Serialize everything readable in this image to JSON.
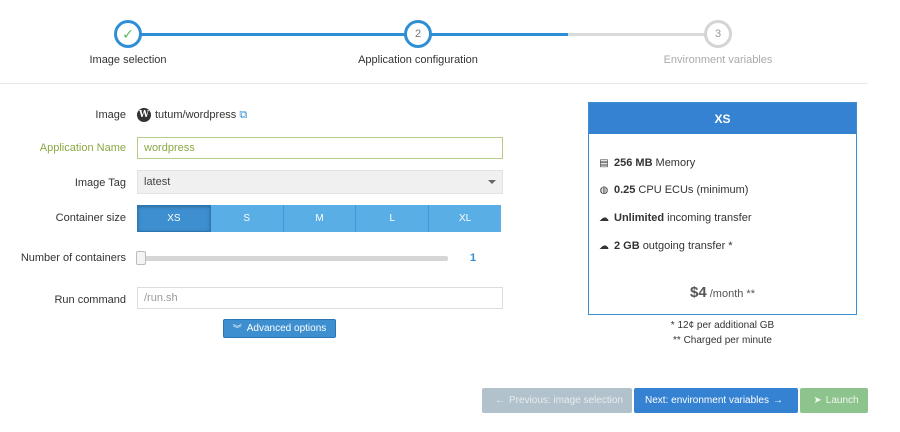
{
  "wizard": {
    "steps": [
      {
        "label": "Image selection",
        "marker": "✓",
        "state": "done"
      },
      {
        "label": "Application configuration",
        "marker": "2",
        "state": "active"
      },
      {
        "label": "Environment variables",
        "marker": "3",
        "state": "todo"
      }
    ]
  },
  "form": {
    "image": {
      "label": "Image",
      "value": "tutum/wordpress",
      "icon": "wordpress-icon",
      "link_icon": "external-link-icon"
    },
    "app_name": {
      "label": "Application Name",
      "value": "wordpress"
    },
    "image_tag": {
      "label": "Image Tag",
      "value": "latest"
    },
    "container_size": {
      "label": "Container size",
      "options": [
        "XS",
        "S",
        "M",
        "L",
        "XL"
      ],
      "selected": "XS"
    },
    "num_containers": {
      "label": "Number of containers",
      "value": "1"
    },
    "run_command": {
      "label": "Run command",
      "placeholder": "/run.sh"
    },
    "advanced_label": "Advanced options"
  },
  "plan": {
    "title": "XS",
    "features": [
      {
        "icon": "memory-icon",
        "bold": "256 MB",
        "text": "Memory"
      },
      {
        "icon": "cpu-icon",
        "bold": "0.25",
        "text": "CPU ECUs (minimum)"
      },
      {
        "icon": "cloud-download-icon",
        "bold": "Unlimited",
        "text": "incoming transfer"
      },
      {
        "icon": "cloud-upload-icon",
        "bold": "2 GB",
        "text": "outgoing transfer *"
      }
    ],
    "price": "$4",
    "period": "/month **",
    "notes": [
      "* 12¢ per additional GB",
      "** Charged per minute"
    ]
  },
  "buttons": {
    "prev": "Previous: image selection",
    "next": "Next: environment variables",
    "launch": "Launch"
  },
  "colors": {
    "primary": "#3582d2",
    "success": "#5cb85c",
    "label_green": "#8aa843"
  }
}
